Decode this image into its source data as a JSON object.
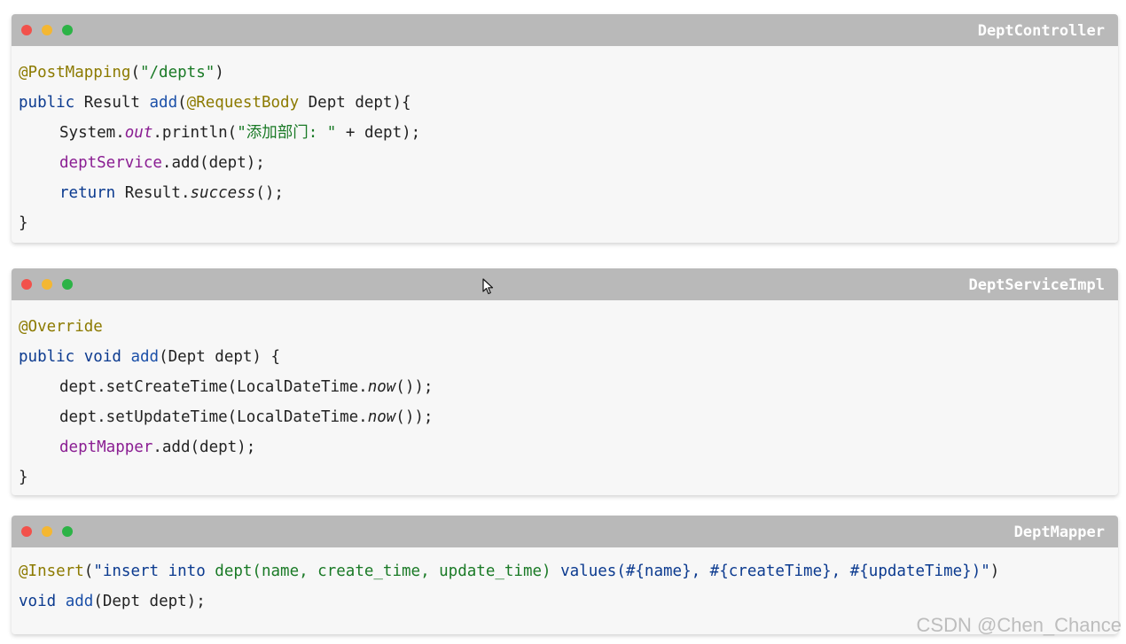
{
  "panels": [
    {
      "title": "DeptController",
      "lines": {
        "l1": {
          "a": "@PostMapping",
          "b": "(",
          "c": "\"/depts\"",
          "d": ")"
        },
        "l2": {
          "a": "public",
          "b": " Result ",
          "c": "add",
          "d": "(",
          "e": "@RequestBody",
          "f": " Dept dept){"
        },
        "l3": {
          "a": "System.",
          "b": "out",
          "c": ".println(",
          "d": "\"添加部门: \"",
          "e": " + dept);"
        },
        "l4": {
          "a": "deptService",
          "b": ".add(dept);"
        },
        "l5": {
          "a": "return",
          "b": " Result.",
          "c": "success",
          "d": "();"
        },
        "l6": {
          "a": "}"
        }
      }
    },
    {
      "title": "DeptServiceImpl",
      "lines": {
        "l1": {
          "a": "@Override"
        },
        "l2": {
          "a": "public",
          "b": " ",
          "c": "void",
          "d": " ",
          "e": "add",
          "f": "(Dept dept) {"
        },
        "l3": {
          "a": "dept.setCreateTime(LocalDateTime.",
          "b": "now",
          "c": "());"
        },
        "l4": {
          "a": "dept.setUpdateTime(LocalDateTime.",
          "b": "now",
          "c": "());"
        },
        "l5": {
          "a": "deptMapper",
          "b": ".add(dept);"
        },
        "l6": {
          "a": "}"
        }
      }
    },
    {
      "title": "DeptMapper",
      "lines": {
        "l1": {
          "a": "@Insert",
          "b": "(",
          "c": "\"insert into ",
          "d": "dept(name, create_time, update_time) ",
          "e": "values(#{name}, #{createTime}, #{updateTime})\"",
          "f": ")"
        },
        "l2": {
          "a": "void",
          "b": " ",
          "c": "add",
          "d": "(Dept dept);"
        }
      }
    }
  ],
  "watermark": "CSDN @Chen_Chance"
}
